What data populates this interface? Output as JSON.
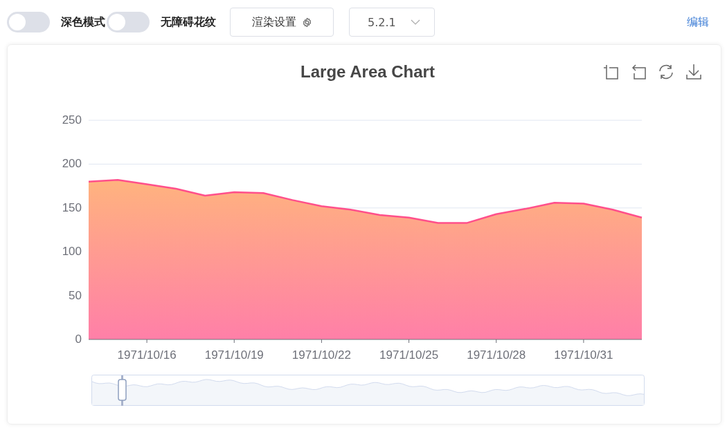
{
  "toolbar": {
    "toggles": [
      {
        "label": "深色模式",
        "on": false
      },
      {
        "label": "无障碍花纹",
        "on": false
      }
    ],
    "render_button": "渲染设置",
    "version_select": {
      "value": "5.2.1"
    },
    "edit_link": "编辑"
  },
  "chart": {
    "chart_data": {
      "type": "area",
      "title": "Large Area Chart",
      "categories": [
        null,
        null,
        "1971/10/16",
        null,
        null,
        "1971/10/19",
        null,
        null,
        "1971/10/22",
        null,
        null,
        "1971/10/25",
        null,
        null,
        "1971/10/28",
        null,
        null,
        "1971/10/31",
        null,
        null
      ],
      "series": [
        {
          "color": "#ff4f8b",
          "values": [
            180,
            182,
            177,
            172,
            164,
            168,
            167,
            159,
            152,
            148,
            142,
            139,
            133,
            133,
            143,
            149,
            156,
            155,
            148,
            139
          ]
        }
      ],
      "ylim": [
        0,
        250
      ],
      "yticks": [
        0,
        50,
        100,
        150,
        200,
        250
      ]
    }
  }
}
